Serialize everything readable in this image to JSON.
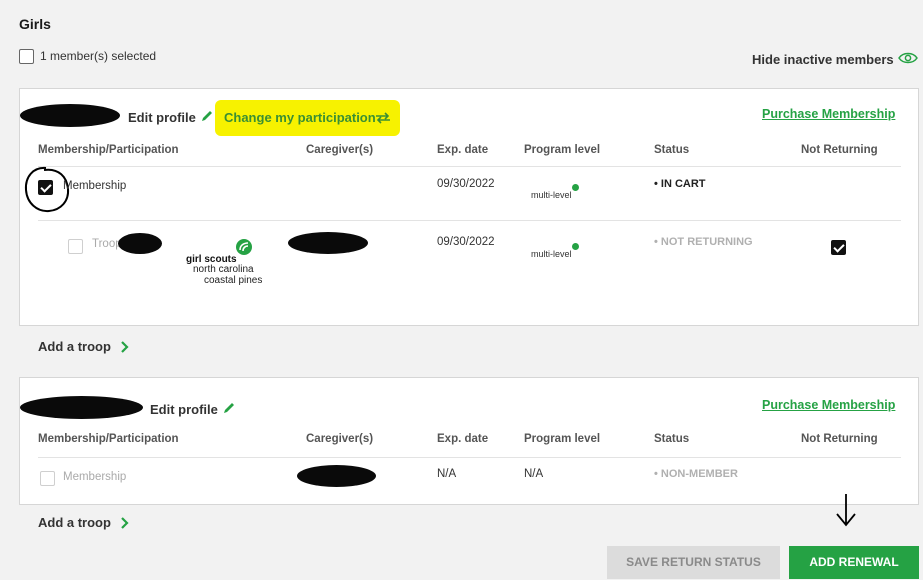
{
  "section": {
    "title": "Girls"
  },
  "selection": {
    "label": "1 member(s) selected"
  },
  "filter": {
    "hide_inactive": "Hide inactive members",
    "icon": "eye-icon"
  },
  "colors": {
    "accent": "#25a244",
    "highlight": "#f7f200"
  },
  "columns": [
    "Membership/Participation",
    "Caregiver(s)",
    "Exp. date",
    "Program level",
    "Status",
    "Not Returning"
  ],
  "member1": {
    "edit_profile": "Edit profile",
    "change_participation": "Change my participation",
    "purchase": "Purchase Membership",
    "rows": [
      {
        "name": "Membership",
        "exp": "09/30/2022",
        "level": "multi-level",
        "status": "IN CART"
      },
      {
        "name": "Troop",
        "exp": "09/30/2022",
        "level": "multi-level",
        "status": "NOT RETURNING"
      }
    ],
    "council": {
      "brand": "girl scouts",
      "line1": "north carolina",
      "line2": "coastal pines"
    },
    "add_troop": "Add a troop"
  },
  "member2": {
    "edit_profile": "Edit profile",
    "purchase": "Purchase Membership",
    "rows": [
      {
        "name": "Membership",
        "exp": "N/A",
        "level": "N/A",
        "status": "NON-MEMBER"
      }
    ],
    "add_troop": "Add a troop"
  },
  "actions": {
    "save": "SAVE RETURN STATUS",
    "add": "ADD RENEWAL"
  }
}
